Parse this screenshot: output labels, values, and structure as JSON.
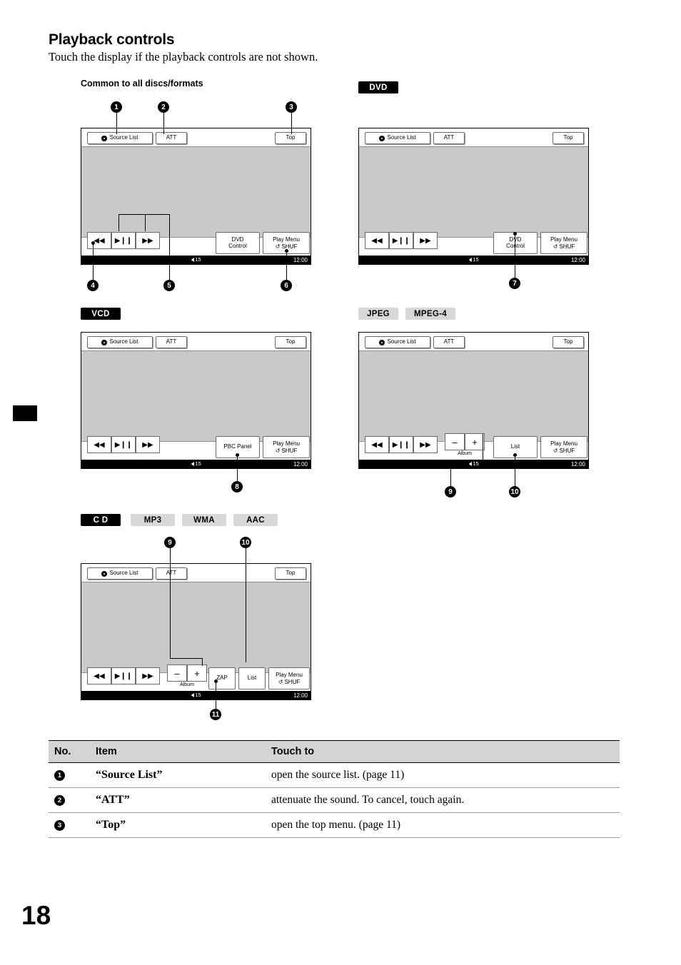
{
  "page": {
    "title": "Playback controls",
    "subtitle": "Touch the display if the playback controls are not shown.",
    "number": "18"
  },
  "sections": {
    "common_label": "Common to all discs/formats",
    "tags": {
      "dvd": "DVD",
      "vcd": "VCD",
      "jpeg": "JPEG",
      "mpeg4": "MPEG-4",
      "cd": "C D",
      "mp3": "MP3",
      "wma": "WMA",
      "aac": "AAC"
    }
  },
  "panel": {
    "source_list": "Source List",
    "att": "ATT",
    "top": "Top",
    "dvd_control_l1": "DVD",
    "dvd_control_l2": "Control",
    "play_menu_l1": "Play Menu",
    "play_menu_l2": "SHUF",
    "pbc_panel": "PBC Panel",
    "list": "List",
    "zap": "ZAP",
    "album": "Album",
    "minus": "–",
    "plus": "+",
    "prev": "◀◀",
    "playpause": "▶❙❙",
    "next": "▶▶",
    "volume": "15",
    "clock": "12:00"
  },
  "callouts": {
    "c1": "1",
    "c2": "2",
    "c3": "3",
    "c4": "4",
    "c5": "5",
    "c6": "6",
    "c7": "7",
    "c8": "8",
    "c9": "9",
    "c10": "10",
    "c11": "11",
    "c9b": "9",
    "c10b": "10"
  },
  "table": {
    "headers": {
      "no": "No.",
      "item": "Item",
      "touch_to": "Touch to"
    },
    "rows": [
      {
        "no": "1",
        "item": "“Source List”",
        "desc": "open the source list. (page 11)"
      },
      {
        "no": "2",
        "item": "“ATT”",
        "desc": "attenuate the sound. To cancel, touch again."
      },
      {
        "no": "3",
        "item": "“Top”",
        "desc": "open the top menu. (page 11)"
      }
    ]
  }
}
